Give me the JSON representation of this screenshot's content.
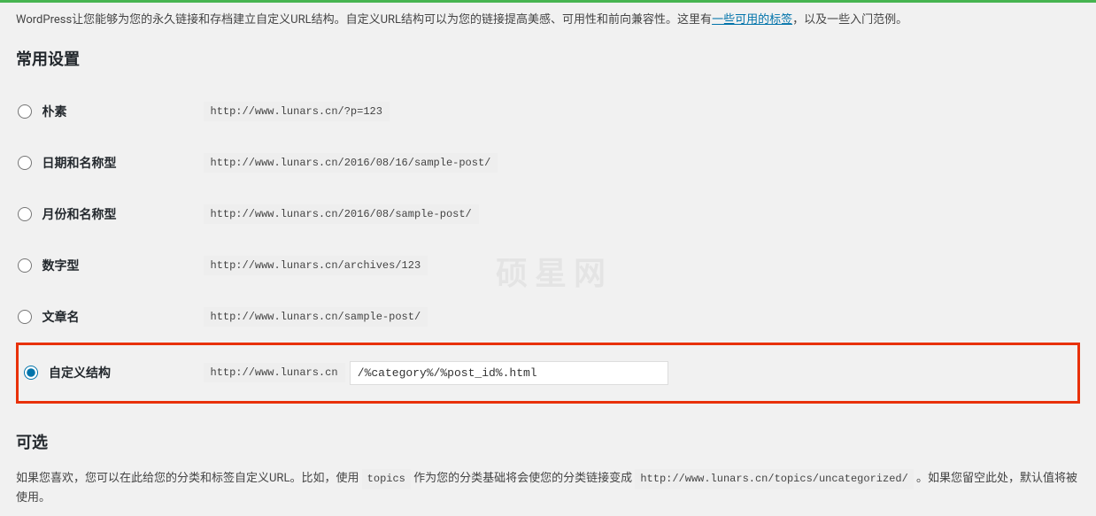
{
  "intro": {
    "text_before": "WordPress让您能够为您的永久链接和存档建立自定义URL结构。自定义URL结构可以为您的链接提高美感、可用性和前向兼容性。这里有",
    "link_text": "一些可用的标签",
    "text_after": "，以及一些入门范例。"
  },
  "section_title": "常用设置",
  "options": {
    "plain": {
      "label": "朴素",
      "example": "http://www.lunars.cn/?p=123"
    },
    "date_name": {
      "label": "日期和名称型",
      "example": "http://www.lunars.cn/2016/08/16/sample-post/"
    },
    "month_name": {
      "label": "月份和名称型",
      "example": "http://www.lunars.cn/2016/08/sample-post/"
    },
    "numeric": {
      "label": "数字型",
      "example": "http://www.lunars.cn/archives/123"
    },
    "post_name": {
      "label": "文章名",
      "example": "http://www.lunars.cn/sample-post/"
    },
    "custom": {
      "label": "自定义结构",
      "prefix": "http://www.lunars.cn",
      "value": "/%category%/%post_id%.html"
    }
  },
  "optional": {
    "title": "可选",
    "desc_before": "如果您喜欢，您可以在此给您的分类和标签自定义URL。比如，使用 ",
    "code1": "topics",
    "desc_mid": " 作为您的分类基础将会使您的分类链接变成 ",
    "code2": "http://www.lunars.cn/topics/uncategorized/",
    "desc_after": " 。如果您留空此处，默认值将被使用。"
  },
  "watermark": "硕星网"
}
